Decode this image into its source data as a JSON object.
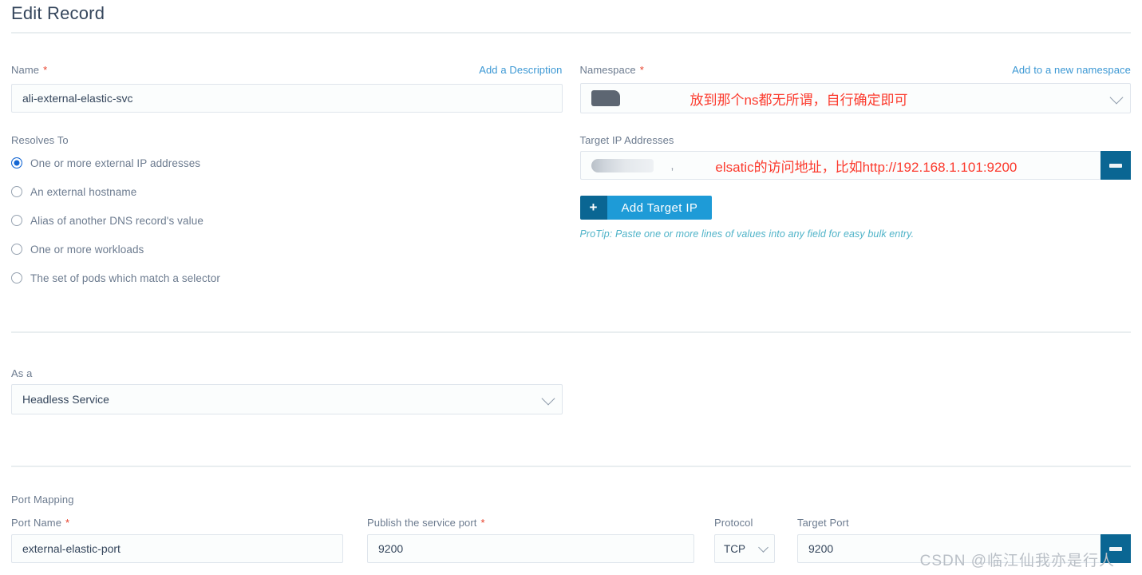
{
  "header": {
    "title": "Edit Record"
  },
  "name_field": {
    "label": "Name",
    "required_marker": "*",
    "add_description_link": "Add a Description",
    "value": "ali-external-elastic-svc"
  },
  "namespace_field": {
    "label": "Namespace",
    "required_marker": "*",
    "add_namespace_link": "Add to a new namespace",
    "value": "",
    "annotation": "放到那个ns都无所谓，自行确定即可"
  },
  "resolves_to": {
    "label": "Resolves To",
    "options": [
      {
        "label": "One or more external IP addresses",
        "selected": true
      },
      {
        "label": "An external hostname",
        "selected": false
      },
      {
        "label": "Alias of another DNS record's value",
        "selected": false
      },
      {
        "label": "One or more workloads",
        "selected": false
      },
      {
        "label": "The set of pods which match a selector",
        "selected": false
      }
    ]
  },
  "target_ip": {
    "label": "Target IP Addresses",
    "value": "",
    "separator": ",",
    "annotation": "elsatic的访问地址，比如http://192.168.1.101:9200",
    "remove_button_label": "−",
    "add_button_label": "Add Target IP",
    "add_button_plus": "+",
    "protip": "ProTip: Paste one or more lines of values into any field for easy bulk entry."
  },
  "as_a": {
    "label": "As a",
    "value": "Headless Service"
  },
  "port_mapping": {
    "section_label": "Port Mapping",
    "columns": {
      "port_name": {
        "label": "Port Name",
        "required_marker": "*",
        "value": "external-elastic-port"
      },
      "service_port": {
        "label": "Publish the service port",
        "required_marker": "*",
        "value": "9200"
      },
      "protocol": {
        "label": "Protocol",
        "value": "TCP"
      },
      "target_port": {
        "label": "Target Port",
        "value": "9200"
      }
    },
    "remove_button_label": "−"
  },
  "watermark": {
    "text": "CSDN @临江仙我亦是行人"
  },
  "colors": {
    "accent_blue": "#1e9bd7",
    "accent_dark_blue": "#0a6693",
    "link_blue": "#3c98d4",
    "radio_blue": "#1567d3",
    "required_red": "#e8402a",
    "annotation_red": "#fb3a2d",
    "protip_teal": "#4fb3c8",
    "divider": "#e9eef0",
    "title_text": "#35465c",
    "label_text": "#6c7b8f"
  }
}
